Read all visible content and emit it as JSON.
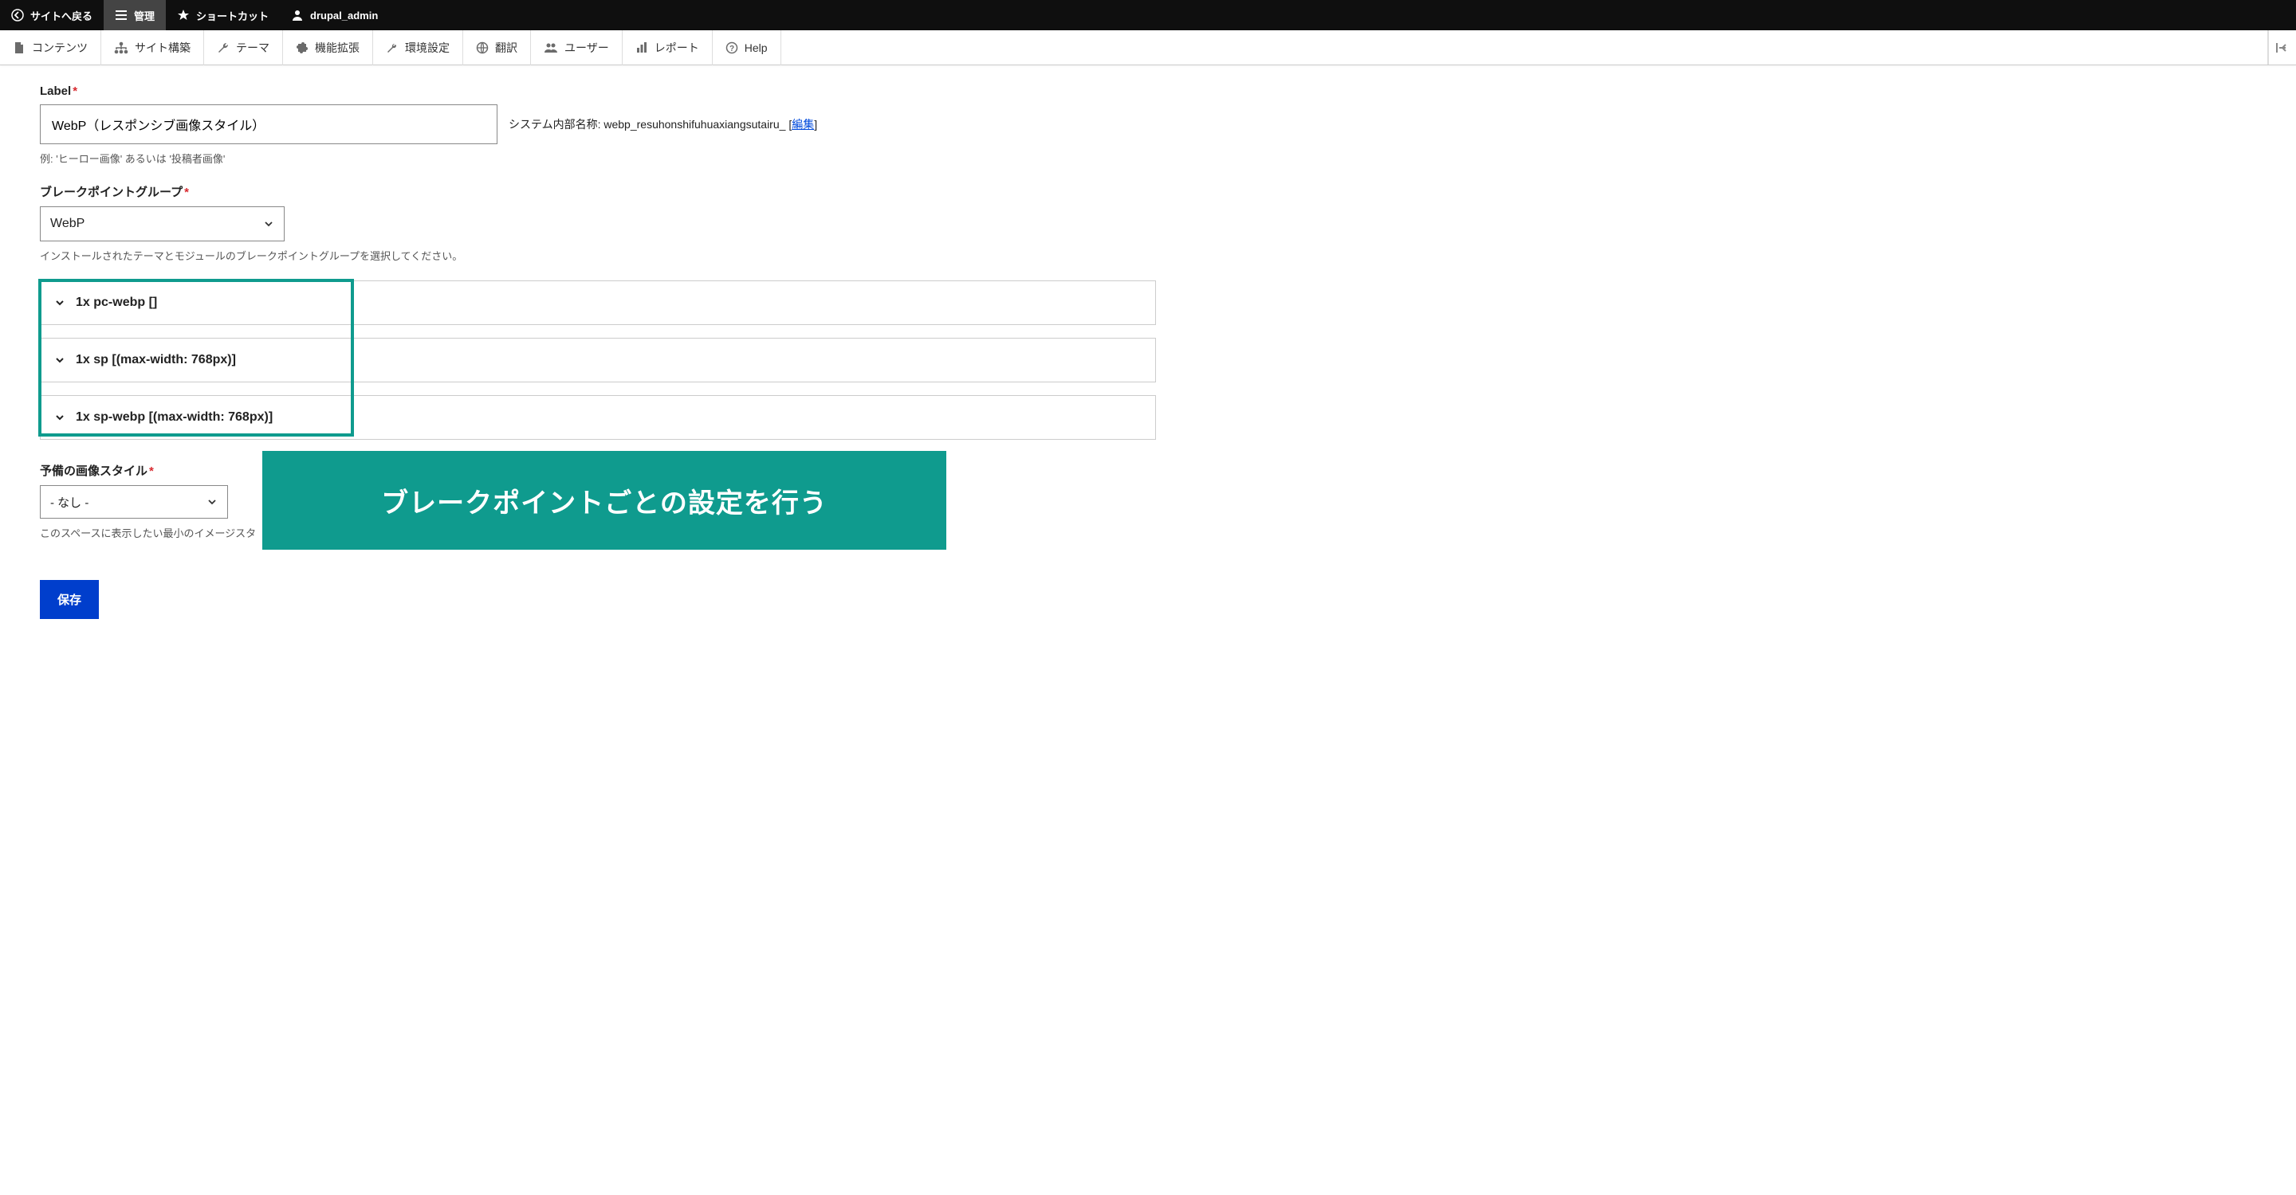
{
  "topbar": {
    "back_to_site": "サイトへ戻る",
    "manage": "管理",
    "shortcuts": "ショートカット",
    "username": "drupal_admin"
  },
  "adminbar": {
    "content": "コンテンツ",
    "structure": "サイト構築",
    "appearance": "テーマ",
    "extend": "機能拡張",
    "configuration": "環境設定",
    "translate": "翻訳",
    "people": "ユーザー",
    "reports": "レポート",
    "help": "Help"
  },
  "form": {
    "label_label": "Label",
    "label_value": "WebP（レスポンシブ画像スタイル）",
    "label_description": "例: 'ヒーロー画像' あるいは '投稿者画像'",
    "machine_name_prefix": "システム内部名称: ",
    "machine_name_value": "webp_resuhonshifuhuaxiangsutairu_",
    "machine_name_edit": "編集",
    "breakpoint_group_label": "ブレークポイントグループ",
    "breakpoint_group_value": "WebP",
    "breakpoint_group_description": "インストールされたテーマとモジュールのブレークポイントグループを選択してください。",
    "fallback_label": "予備の画像スタイル",
    "fallback_value": "- なし -",
    "fallback_description": "このスペースに表示したい最小のイメージスタ",
    "save": "保存"
  },
  "breakpoints": [
    {
      "label": "1x pc-webp []"
    },
    {
      "label": "1x sp [(max-width: 768px)]"
    },
    {
      "label": "1x sp-webp [(max-width: 768px)]"
    }
  ],
  "callout": {
    "text": "ブレークポイントごとの設定を行う"
  }
}
